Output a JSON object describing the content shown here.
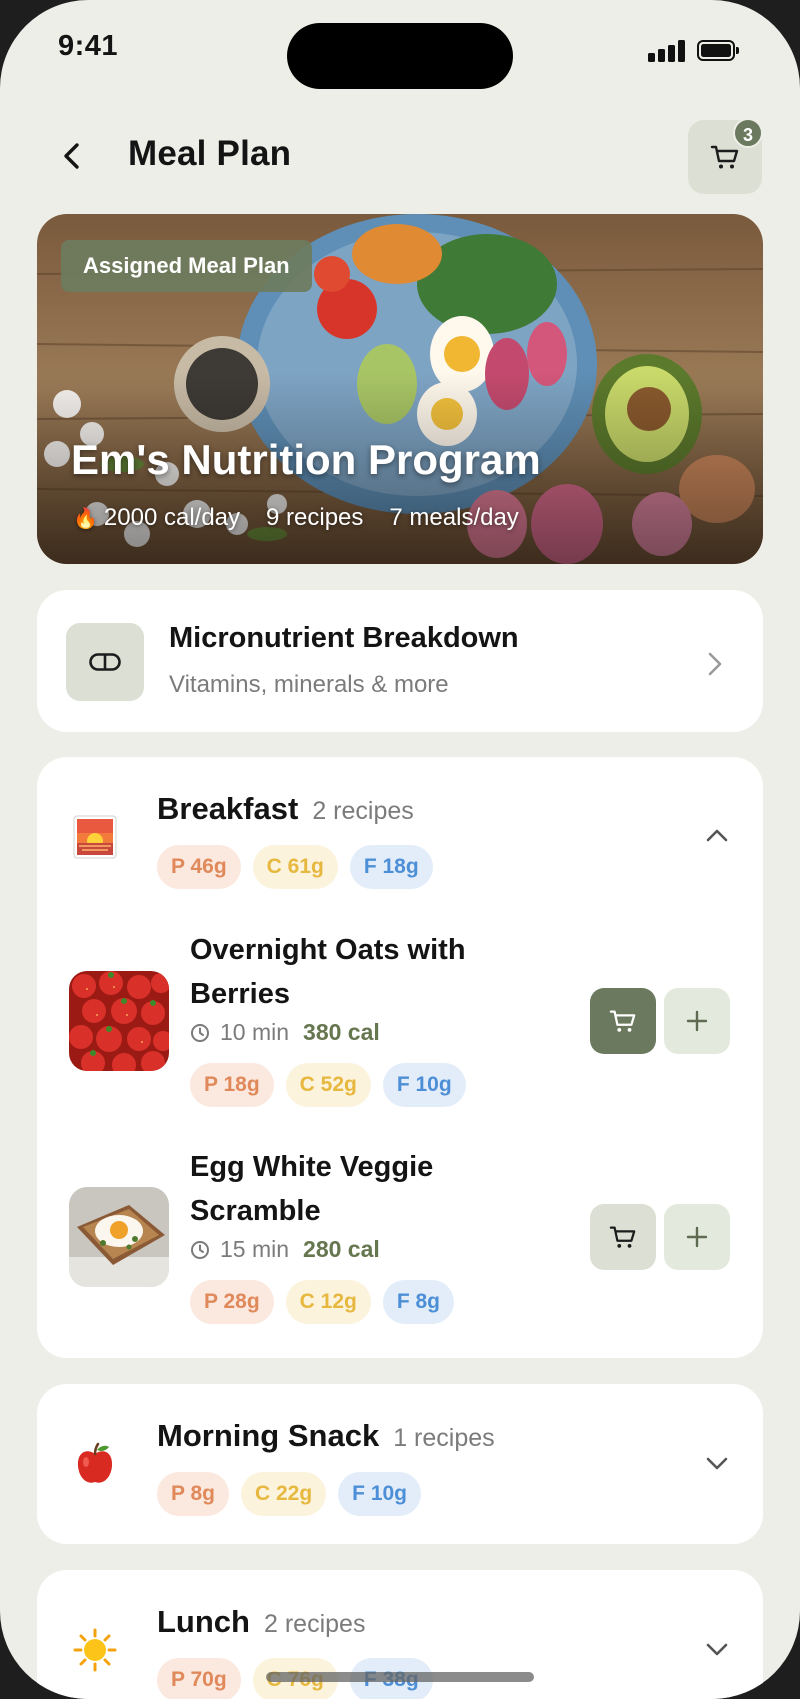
{
  "status_bar": {
    "time": "9:41"
  },
  "header": {
    "title": "Meal Plan",
    "cart_count": "3"
  },
  "hero": {
    "chip": "Assigned Meal Plan",
    "title": "Em's Nutrition Program",
    "calories": "2000 cal/day",
    "recipes": "9 recipes",
    "meals": "7 meals/day"
  },
  "micronutrients": {
    "title": "Micronutrient Breakdown",
    "subtitle": "Vitamins, minerals & more"
  },
  "meals": [
    {
      "title": "Breakfast",
      "count": "2 recipes",
      "icon": "sunrise-icon",
      "macros": {
        "p": "P 46g",
        "c": "C 61g",
        "f": "F 18g"
      },
      "expanded": true,
      "recipes": [
        {
          "name": "Overnight Oats with Berries",
          "time": "10 min",
          "cal": "380 cal",
          "macros": {
            "p": "P 18g",
            "c": "C 52g",
            "f": "F 10g"
          },
          "in_cart": true,
          "image": "strawberries-image"
        },
        {
          "name": "Egg White Veggie Scramble",
          "time": "15 min",
          "cal": "280 cal",
          "macros": {
            "p": "P 28g",
            "c": "C 12g",
            "f": "F 8g"
          },
          "in_cart": false,
          "image": "egg-toast-image"
        }
      ]
    },
    {
      "title": "Morning Snack",
      "count": "1 recipes",
      "icon": "apple-icon",
      "macros": {
        "p": "P 8g",
        "c": "C 22g",
        "f": "F 10g"
      },
      "expanded": false
    },
    {
      "title": "Lunch",
      "count": "2 recipes",
      "icon": "sun-icon",
      "macros": {
        "p": "P 70g",
        "c": "C 76g",
        "f": "F 38g"
      },
      "expanded": false
    }
  ],
  "colors": {
    "accent": "#6b7a5e",
    "accent_light": "#dcdfd3",
    "background": "#eeeee8",
    "protein": "#e0895a",
    "carbs": "#e7b840",
    "fat": "#4d8fd6"
  }
}
